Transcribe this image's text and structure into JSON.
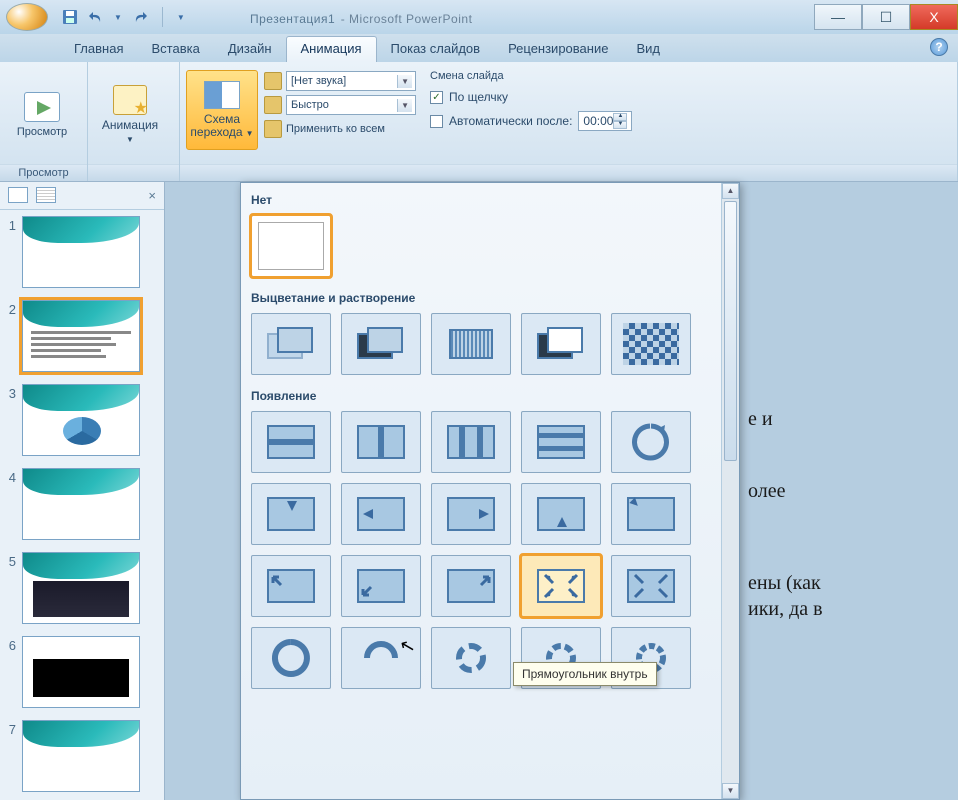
{
  "titlebar": {
    "document": "Презентация1",
    "app": "Microsoft PowerPoint"
  },
  "window_controls": {
    "min": "—",
    "max": "☐",
    "close": "X"
  },
  "tabs": {
    "items": [
      "Главная",
      "Вставка",
      "Дизайн",
      "Анимация",
      "Показ слайдов",
      "Рецензирование",
      "Вид"
    ],
    "active_index": 3
  },
  "ribbon": {
    "preview_group": {
      "button": "Просмотр",
      "label": "Просмотр"
    },
    "animation_group": {
      "button": "Анимация",
      "dropdown_marker": "▾"
    },
    "transition_group": {
      "button_line1": "Схема",
      "button_line2": "перехода",
      "sound_label": "[Нет звука]",
      "speed_label": "Быстро",
      "apply_all": "Применить ко всем"
    },
    "advance": {
      "header": "Смена слайда",
      "on_click": "По щелчку",
      "on_click_checked": true,
      "after": "Автоматически после:",
      "after_checked": false,
      "time_value": "00:00"
    }
  },
  "slides": {
    "count": 7,
    "selected_index": 2
  },
  "gallery": {
    "sections": {
      "none": "Нет",
      "fade": "Выцветание и растворение",
      "appear": "Появление"
    },
    "tooltip": "Прямоугольник внутрь"
  },
  "peek": {
    "t1": "е и",
    "t2": "олее",
    "t3": "ены (как",
    "t4": "ики, да в"
  }
}
